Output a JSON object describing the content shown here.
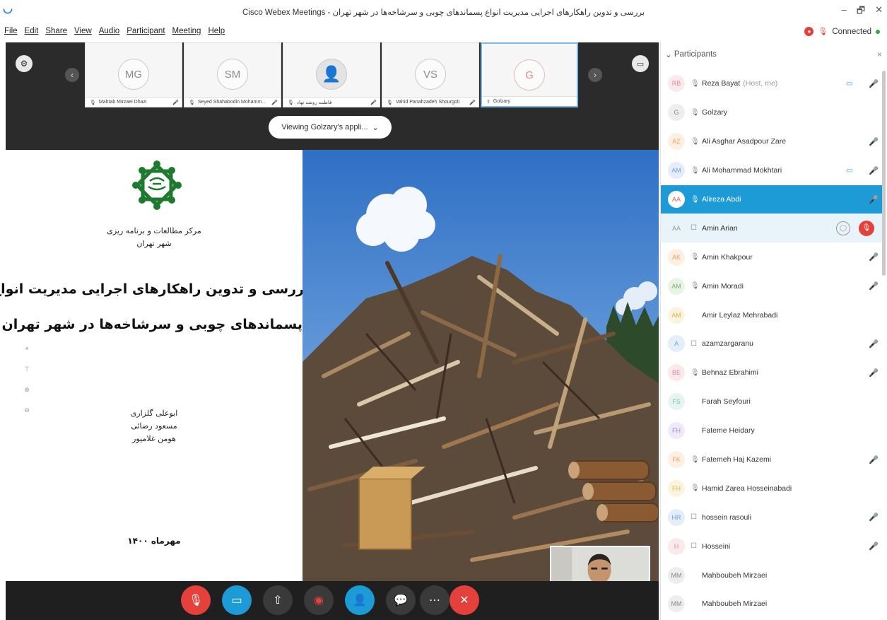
{
  "window": {
    "title": "Cisco Webex Meetings - بررسی و تدوین راهکارهای اجرایی مدیریت انواع پسماندهای چوبی و سرشاخه‌ها در شهر تهران",
    "controls": [
      "–",
      "🗗",
      "✕"
    ]
  },
  "menu": {
    "items": [
      "File",
      "Edit",
      "Share",
      "View",
      "Audio",
      "Participant",
      "Meeting",
      "Help"
    ],
    "status": "Connected",
    "status_color": "#2ba84a"
  },
  "video_strip": {
    "tiles": [
      {
        "initials": "MG",
        "name": "Mahtab Mirzaei Dhazi",
        "muted": true
      },
      {
        "initials": "SM",
        "name": "Seyed Shahabodin Mohamm...",
        "muted": true
      },
      {
        "initials": "",
        "name": "فاطمه روشه نهاد",
        "muted": true
      },
      {
        "initials": "VS",
        "name": "Vahid Panahzadeh Shourgoli",
        "muted": true
      },
      {
        "initials": "G",
        "name": "Golzary",
        "muted": false,
        "active": true
      }
    ]
  },
  "viewing_pill": {
    "label": "Viewing Golzary's appli..."
  },
  "slide": {
    "org_line1": "مرکز مطالعات و برنامه ریزی",
    "org_line2": "شهر تهران",
    "title_line1": "بررسی و تدوین راهکارهای اجرایی مدیریت انواع",
    "title_line2": "پسماندهای چوبی و سرشاخه‌ها در شهر تهران",
    "authors": [
      "ابوعلی گلزاری",
      "مسعود رضائی",
      "هومن غلامپور"
    ],
    "date": "مهرماه ۱۴۰۰"
  },
  "participants_panel": {
    "header": "Participants",
    "close": "×",
    "rows": [
      {
        "initials": "RB",
        "name": "Reza Bayat",
        "suffix": "(Host, me)",
        "audio": "mic",
        "camera": true,
        "muted": true,
        "color": "rose"
      },
      {
        "initials": "G",
        "name": "Golzary",
        "suffix": "",
        "audio": "mic",
        "camera": false,
        "muted": false,
        "color": "gray"
      },
      {
        "initials": "AZ",
        "name": "Ali Asghar Asadpour Zare",
        "suffix": "",
        "audio": "mic",
        "camera": false,
        "muted": true,
        "color": "orange"
      },
      {
        "initials": "AM",
        "name": "Ali Mohammad Mokhtari",
        "suffix": "",
        "audio": "mic",
        "camera": true,
        "muted": true,
        "color": "blue"
      },
      {
        "initials": "AA",
        "name": "Alireza Abdi",
        "suffix": "",
        "audio": "mic",
        "camera": false,
        "muted": true,
        "color": "white",
        "selected": true
      },
      {
        "initials": "AA",
        "name": "Amin Arian",
        "suffix": "",
        "audio": "phone",
        "camera": false,
        "muted": true,
        "color": "plain",
        "hovered": true
      },
      {
        "initials": "AK",
        "name": "Amin Khakpour",
        "suffix": "",
        "audio": "mic",
        "camera": false,
        "muted": true,
        "color": "orange"
      },
      {
        "initials": "AM",
        "name": "Amin Moradi",
        "suffix": "",
        "audio": "mic",
        "camera": false,
        "muted": true,
        "color": "green"
      },
      {
        "initials": "AM",
        "name": "Amir Leylaz Mehrabadi",
        "suffix": "",
        "audio": "none",
        "camera": false,
        "muted": false,
        "color": "yellow"
      },
      {
        "initials": "A",
        "name": "azamzargaranu",
        "suffix": "",
        "audio": "phone",
        "camera": false,
        "muted": true,
        "color": "blue"
      },
      {
        "initials": "BE",
        "name": "Behnaz Ebrahimi",
        "suffix": "",
        "audio": "mic",
        "camera": false,
        "muted": true,
        "color": "rose"
      },
      {
        "initials": "FS",
        "name": "Farah Seyfouri",
        "suffix": "",
        "audio": "none",
        "camera": false,
        "muted": false,
        "color": "teal"
      },
      {
        "initials": "FH",
        "name": "Fateme Heidary",
        "suffix": "",
        "audio": "none",
        "camera": false,
        "muted": false,
        "color": "purple"
      },
      {
        "initials": "FK",
        "name": "Fatemeh Haj Kazemi",
        "suffix": "",
        "audio": "mic",
        "camera": false,
        "muted": true,
        "color": "orange"
      },
      {
        "initials": "FH",
        "name": "Hamid Zarea Hosseinabadi",
        "suffix": "",
        "audio": "mic",
        "camera": false,
        "muted": false,
        "color": "yellow"
      },
      {
        "initials": "HR",
        "name": "hossein rasouli",
        "suffix": "",
        "audio": "phone",
        "camera": false,
        "muted": true,
        "color": "blue"
      },
      {
        "initials": "H",
        "name": "Hosseini",
        "suffix": "",
        "audio": "phone",
        "camera": false,
        "muted": true,
        "color": "rose"
      },
      {
        "initials": "MM",
        "name": "Mahboubeh Mirzaei",
        "suffix": "",
        "audio": "none",
        "camera": false,
        "muted": false,
        "color": "gray"
      },
      {
        "initials": "MM",
        "name": "Mahboubeh Mirzaei",
        "suffix": "",
        "audio": "none",
        "camera": false,
        "muted": false,
        "color": "gray"
      }
    ]
  },
  "controls": {
    "buttons": [
      "mute",
      "video",
      "share",
      "record",
      "participants",
      "chat",
      "more",
      "leave"
    ]
  },
  "colors": {
    "accent": "#1c9bd7",
    "danger": "#e4403c",
    "dark": "#2b2b2b"
  }
}
